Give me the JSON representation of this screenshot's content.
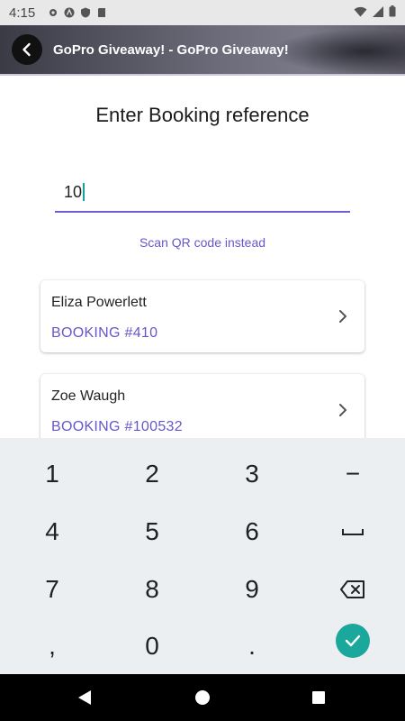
{
  "status_bar": {
    "time": "4:15"
  },
  "app_bar": {
    "title": "GoPro Giveaway! - GoPro Giveaway!"
  },
  "main": {
    "heading": "Enter Booking reference",
    "reference_input": {
      "value": "10"
    },
    "scan_link": "Scan QR code instead",
    "bookings": [
      {
        "name": "Eliza Powerlett",
        "booking": "BOOKING #410"
      },
      {
        "name": "Zoe Waugh",
        "booking": "BOOKING #100532"
      }
    ]
  },
  "keyboard": {
    "rows": [
      [
        "1",
        "2",
        "3",
        "−"
      ],
      [
        "4",
        "5",
        "6",
        "space"
      ],
      [
        "7",
        "8",
        "9",
        "backspace"
      ],
      [
        ",",
        "0",
        ".",
        "done"
      ]
    ],
    "accent_color": "#1ba89c"
  },
  "colors": {
    "accent": "#6c5fcf",
    "link": "#6558c9"
  }
}
